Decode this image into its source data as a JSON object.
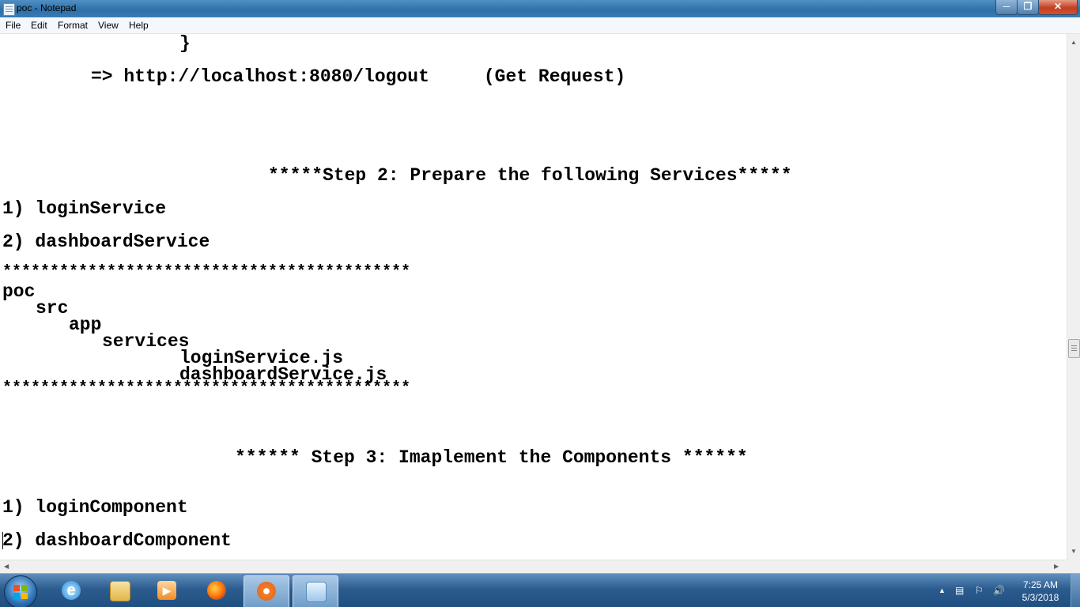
{
  "window": {
    "title": "poc - Notepad",
    "controls": [
      "minimize",
      "maximize",
      "close"
    ]
  },
  "menu": [
    "File",
    "Edit",
    "Format",
    "View",
    "Help"
  ],
  "editor": {
    "lines": [
      {
        "id": "brace",
        "text": "}"
      },
      {
        "id": "logout",
        "text": "=> http://localhost:8080/logout     (Get Request)"
      },
      {
        "id": "step2",
        "text": "*****Step 2: Prepare the following Services*****"
      },
      {
        "id": "svc1",
        "text": "1) loginService"
      },
      {
        "id": "svc2",
        "text": "2) dashboardService"
      },
      {
        "id": "stars1",
        "text": "*******************************************"
      },
      {
        "id": "tree-poc",
        "text": "poc"
      },
      {
        "id": "tree-src",
        "text": "src"
      },
      {
        "id": "tree-app",
        "text": "app"
      },
      {
        "id": "tree-services",
        "text": "services"
      },
      {
        "id": "tree-login",
        "text": "loginService.js"
      },
      {
        "id": "tree-dashboard",
        "text": "dashboardService.js"
      },
      {
        "id": "stars2",
        "text": "*******************************************"
      },
      {
        "id": "step3",
        "text": "****** Step 3: Imaplement the Components ******"
      },
      {
        "id": "comp1",
        "text": "1) loginComponent"
      },
      {
        "id": "comp2",
        "text": "2) dashboardComponent"
      }
    ]
  },
  "taskbar": {
    "start": "start-button",
    "pinned": [
      "internet-explorer-icon",
      "file-explorer-icon",
      "media-player-icon",
      "firefox-icon",
      "app-icon",
      "notepad-icon"
    ],
    "clock": {
      "time": "7:25 AM",
      "date": "5/3/2018"
    }
  },
  "colors": {
    "titlebar": "#3b7bb4",
    "taskbar": "#2c5b8e",
    "close": "#c23e22"
  }
}
